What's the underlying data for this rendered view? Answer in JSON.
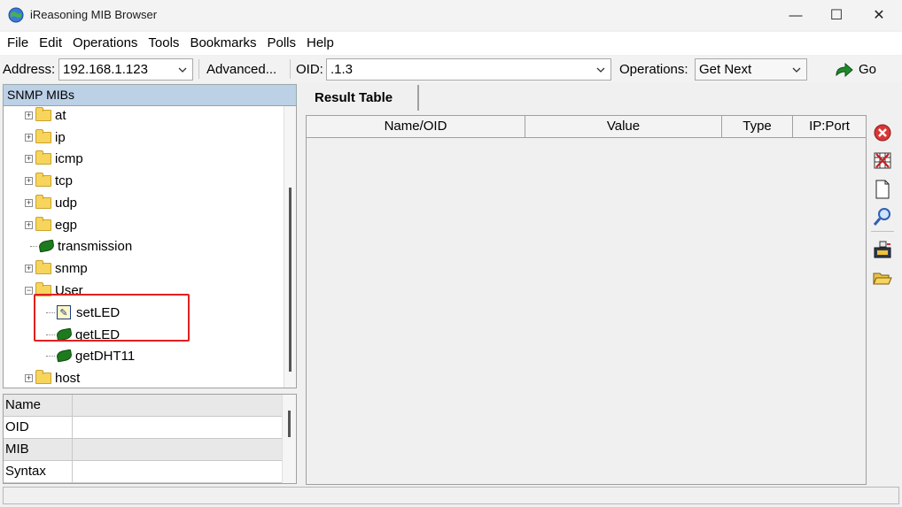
{
  "window": {
    "title": "iReasoning MIB Browser",
    "minimize_glyph": "—",
    "maximize_glyph": "☐",
    "close_glyph": "✕"
  },
  "menu": [
    "File",
    "Edit",
    "Operations",
    "Tools",
    "Bookmarks",
    "Polls",
    "Help"
  ],
  "toolbar": {
    "address_label": "Address:",
    "address_value": "192.168.1.123",
    "advanced_label": "Advanced...",
    "oid_label": "OID:",
    "oid_value": ".1.3",
    "operations_label": "Operations:",
    "operations_value": "Get Next",
    "go_label": "Go"
  },
  "mib_tree": {
    "header": "SNMP MIBs",
    "nodes": [
      {
        "label": "at",
        "kind": "folder",
        "expander": "+"
      },
      {
        "label": "ip",
        "kind": "folder",
        "expander": "+"
      },
      {
        "label": "icmp",
        "kind": "folder",
        "expander": "+"
      },
      {
        "label": "tcp",
        "kind": "folder",
        "expander": "+"
      },
      {
        "label": "udp",
        "kind": "folder",
        "expander": "+"
      },
      {
        "label": "egp",
        "kind": "folder",
        "expander": "+"
      },
      {
        "label": "transmission",
        "kind": "leaf",
        "expander": ""
      },
      {
        "label": "snmp",
        "kind": "folder",
        "expander": "+"
      },
      {
        "label": "User",
        "kind": "folder",
        "expander": "−"
      },
      {
        "label": "setLED",
        "kind": "writable",
        "expander": ""
      },
      {
        "label": "getLED",
        "kind": "leaf",
        "expander": ""
      },
      {
        "label": "getDHT11",
        "kind": "leaf",
        "expander": ""
      },
      {
        "label": "host",
        "kind": "folder",
        "expander": "+"
      }
    ]
  },
  "properties": {
    "rows": [
      {
        "name": "Name",
        "value": ""
      },
      {
        "name": "OID",
        "value": ""
      },
      {
        "name": "MIB",
        "value": ""
      },
      {
        "name": "Syntax",
        "value": ""
      }
    ]
  },
  "result": {
    "tab_label": "Result Table",
    "columns": [
      "Name/OID",
      "Value",
      "Type",
      "IP:Port"
    ]
  },
  "side_tools": [
    "stop-icon",
    "clear-table-icon",
    "new-document-icon",
    "find-icon",
    "export-icon",
    "open-folder-icon"
  ],
  "colors": {
    "tree_header_bg": "#bcd0e6",
    "highlight_box": "#e02020",
    "leaf_green": "#1e7a1e",
    "folder_yellow": "#f7d45b"
  }
}
